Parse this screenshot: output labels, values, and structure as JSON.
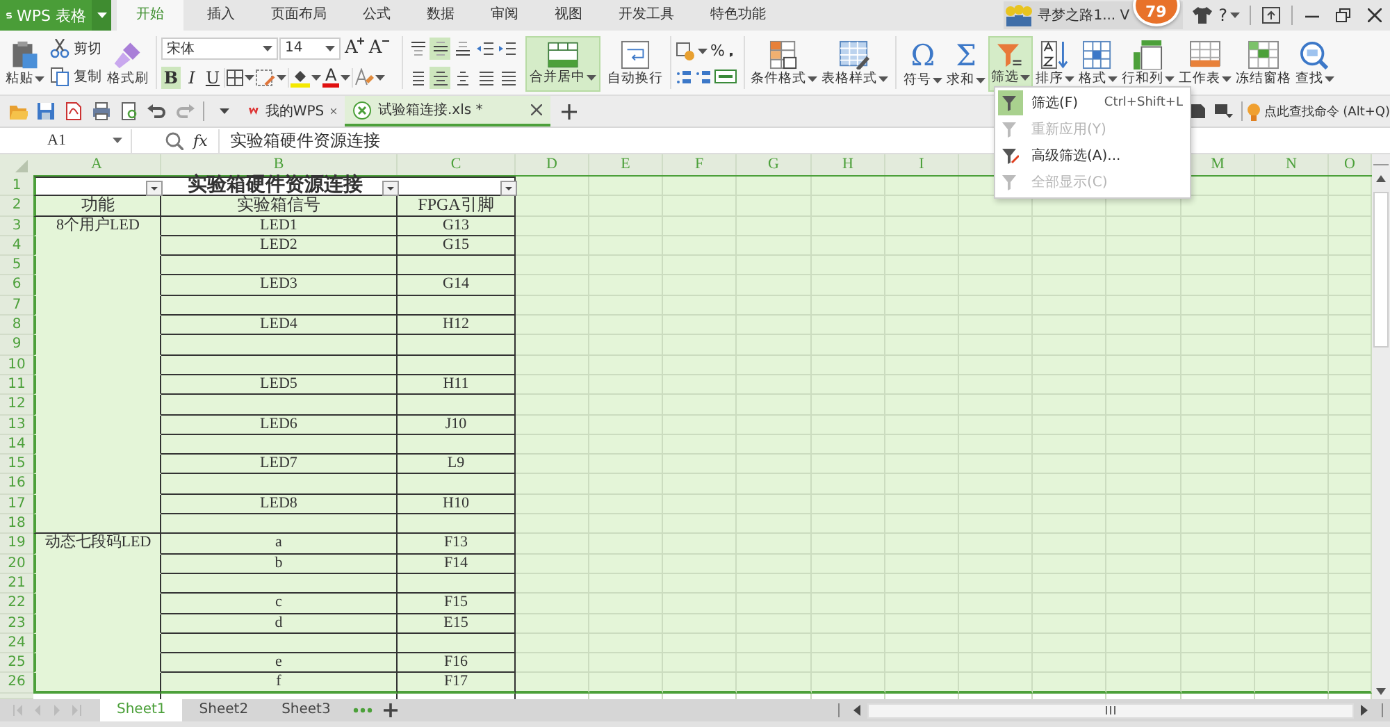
{
  "app": {
    "logo": "WPS 表格"
  },
  "menu_tabs": [
    {
      "label": "开始",
      "selected": true
    },
    {
      "label": "插入",
      "selected": false
    },
    {
      "label": "页面布局",
      "selected": false
    },
    {
      "label": "公式",
      "selected": false
    },
    {
      "label": "数据",
      "selected": false
    },
    {
      "label": "审阅",
      "selected": false
    },
    {
      "label": "视图",
      "selected": false
    },
    {
      "label": "开发工具",
      "selected": false
    },
    {
      "label": "特色功能",
      "selected": false
    }
  ],
  "account": {
    "name": "寻梦之路1... V",
    "badge": "79",
    "help": "?"
  },
  "ribbon": {
    "paste": "粘贴",
    "cut": "剪切",
    "copy": "复制",
    "format_painter": "格式刷",
    "font_name": "宋体",
    "font_size": "14",
    "grow": "A",
    "shrink": "A",
    "font_color": "A",
    "styles": [
      {
        "label": "B",
        "selected": true
      },
      {
        "label": "I",
        "selected": false
      },
      {
        "label": "U",
        "selected": false
      }
    ],
    "align_buttons": [
      {
        "selected": false
      },
      {
        "selected": true
      },
      {
        "selected": false
      },
      {
        "selected": false
      },
      {
        "selected": false
      },
      {
        "selected": false
      },
      {
        "selected": true
      },
      {
        "selected": false
      },
      {
        "selected": false
      },
      {
        "selected": false
      }
    ],
    "merge": {
      "label": "合并居中",
      "selected": true
    },
    "wrap": "自动换行",
    "percent": "%",
    "big_buttons": [
      {
        "label": "条件格式",
        "dropdown": true,
        "selected": false
      },
      {
        "label": "表格样式",
        "dropdown": true,
        "selected": false
      },
      {
        "label": "符号",
        "dropdown": true,
        "selected": false,
        "glyph": "Ω"
      },
      {
        "label": "求和",
        "dropdown": true,
        "selected": false,
        "glyph": "Σ"
      },
      {
        "label": "筛选",
        "dropdown": true,
        "selected": true
      },
      {
        "label": "排序",
        "dropdown": true,
        "selected": false
      },
      {
        "label": "格式",
        "dropdown": true,
        "selected": false
      },
      {
        "label": "行和列",
        "dropdown": true,
        "selected": false
      },
      {
        "label": "工作表",
        "dropdown": true,
        "selected": false
      },
      {
        "label": "冻结窗格",
        "dropdown": false,
        "selected": false
      },
      {
        "label": "查找",
        "dropdown": true,
        "selected": false
      }
    ]
  },
  "doc_tabs": [
    {
      "label": "我的WPS",
      "selected": false
    },
    {
      "label": "试验箱连接.xls *",
      "selected": true
    }
  ],
  "command_search": "点此查找命令 (Alt+Q)",
  "formula_bar": {
    "name_box": "A1",
    "fx": "fx",
    "content": "实验箱硬件资源连接"
  },
  "sheet": {
    "columns": [
      "A",
      "B",
      "C",
      "D",
      "E",
      "F",
      "G",
      "H",
      "I",
      "M",
      "N",
      "O"
    ],
    "title_row": {
      "number": "1",
      "title": "实验箱硬件资源连接"
    },
    "rows": [
      {
        "number": "2",
        "a": "功能",
        "b": "实验箱信号",
        "c": "FPGA引脚"
      },
      {
        "number": "3",
        "a": "8个用户LED",
        "b": "LED1",
        "c": "G13"
      },
      {
        "number": "4",
        "b": "LED2",
        "c": "G15"
      },
      {
        "number": "5"
      },
      {
        "number": "6",
        "b": "LED3",
        "c": "G14"
      },
      {
        "number": "7"
      },
      {
        "number": "8",
        "b": "LED4",
        "c": "H12"
      },
      {
        "number": "9"
      },
      {
        "number": "10"
      },
      {
        "number": "11",
        "b": "LED5",
        "c": "H11"
      },
      {
        "number": "12"
      },
      {
        "number": "13",
        "b": "LED6",
        "c": "J10"
      },
      {
        "number": "14"
      },
      {
        "number": "15",
        "b": "LED7",
        "c": "L9"
      },
      {
        "number": "16"
      },
      {
        "number": "17",
        "b": "LED8",
        "c": "H10"
      },
      {
        "number": "18"
      },
      {
        "number": "19",
        "a": "动态七段码LED",
        "b": "a",
        "c": "F13"
      },
      {
        "number": "20",
        "b": "b",
        "c": "F14"
      },
      {
        "number": "21"
      },
      {
        "number": "22",
        "b": "c",
        "c": "F15"
      },
      {
        "number": "23",
        "b": "d",
        "c": "E15"
      },
      {
        "number": "24"
      },
      {
        "number": "25",
        "b": "e",
        "c": "F16"
      },
      {
        "number": "26",
        "b": "f",
        "c": "F17"
      }
    ]
  },
  "filter_menu": [
    {
      "label": "筛选(F)",
      "shortcut": "Ctrl+Shift+L",
      "selected": true,
      "disabled": false
    },
    {
      "label": "重新应用(Y)",
      "selected": false,
      "disabled": true
    },
    {
      "label": "高级筛选(A)...",
      "selected": false,
      "disabled": false
    },
    {
      "label": "全部显示(C)",
      "selected": false,
      "disabled": true
    }
  ],
  "sheet_tabs": [
    {
      "label": "Sheet1",
      "selected": true
    },
    {
      "label": "Sheet2",
      "selected": false
    },
    {
      "label": "Sheet3",
      "selected": false
    }
  ]
}
